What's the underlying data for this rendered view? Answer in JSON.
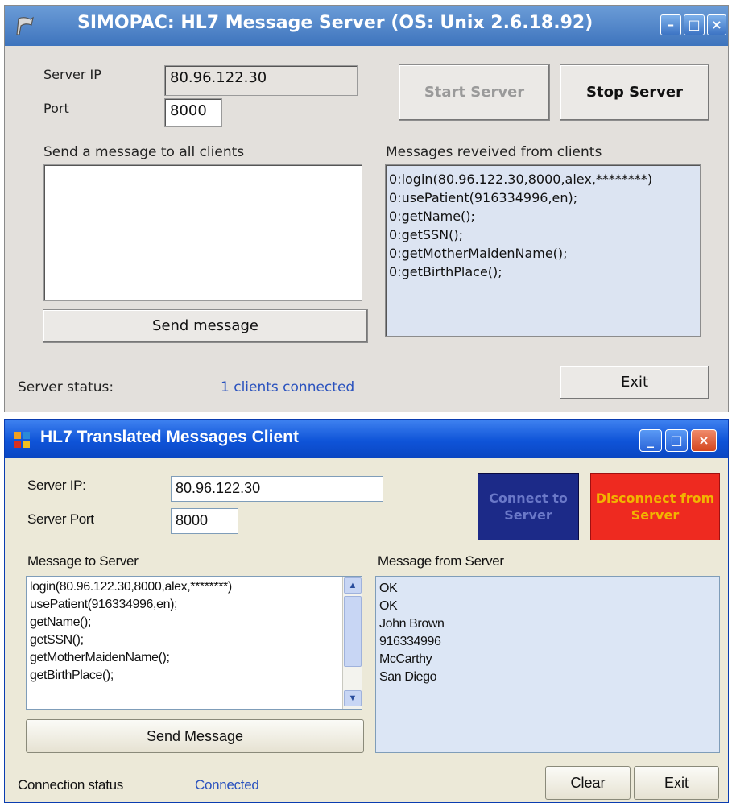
{
  "server": {
    "title": "SIMOPAC: HL7 Message Server (OS: Unix 2.6.18.92)",
    "window_buttons": {
      "minimize": "–",
      "maximize": "□",
      "close": "×"
    },
    "server_ip_label": "Server IP",
    "server_ip_value": "80.96.122.30",
    "port_label": "Port",
    "port_value": "8000",
    "start_button": "Start Server",
    "stop_button": "Stop Server",
    "send_label": "Send a message to all clients",
    "send_button": "Send message",
    "received_label": "Messages reveived from clients",
    "received_messages": [
      "0:login(80.96.122.30,8000,alex,********)",
      "0:usePatient(916334996,en);",
      "0:getName();",
      "0:getSSN();",
      "0:getMotherMaidenName();",
      "0:getBirthPlace();"
    ],
    "status_label": "Server status:",
    "status_value": "1 clients connected",
    "exit_button": "Exit"
  },
  "client": {
    "title": "HL7 Translated Messages Client",
    "window_buttons": {
      "minimize": "_",
      "maximize": "□",
      "close": "×"
    },
    "server_ip_label": "Server IP:",
    "server_ip_value": "80.96.122.30",
    "server_port_label": "Server Port",
    "server_port_value": "8000",
    "connect_button": "Connect to Server",
    "disconnect_button": "Disconnect from Server",
    "message_to_server_label": "Message to Server",
    "message_to_server_lines": [
      "login(80.96.122.30,8000,alex,********)",
      "usePatient(916334996,en);",
      "getName();",
      "getSSN();",
      "getMotherMaidenName();",
      "getBirthPlace();"
    ],
    "send_button": "Send Message",
    "message_from_server_label": "Message from Server",
    "message_from_server_lines": [
      "OK",
      "OK",
      "John Brown",
      "916334996",
      "McCarthy",
      "San Diego"
    ],
    "connection_status_label": "Connection status",
    "connection_status_value": "Connected",
    "clear_button": "Clear",
    "exit_button": "Exit"
  },
  "colors": {
    "connect_bg": "#1c2a88",
    "disconnect_bg": "#ee2a20",
    "disconnect_text": "#f2b400",
    "status_blue": "#2a52be"
  }
}
